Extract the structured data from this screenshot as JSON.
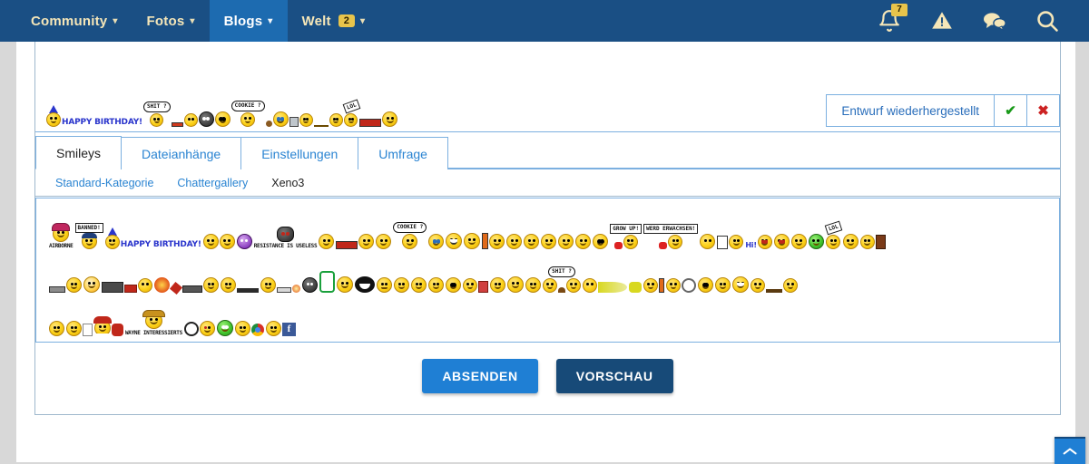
{
  "navbar": {
    "items": [
      {
        "label": "Community",
        "caret": true,
        "active": false,
        "badge": null
      },
      {
        "label": "Fotos",
        "caret": true,
        "active": false,
        "badge": null
      },
      {
        "label": "Blogs",
        "caret": true,
        "active": true,
        "badge": null
      },
      {
        "label": "Welt",
        "caret": true,
        "active": false,
        "badge": "2"
      }
    ],
    "icons": [
      {
        "name": "notification-bell-icon",
        "badge": "7"
      },
      {
        "name": "warning-triangle-icon",
        "badge": null
      },
      {
        "name": "messages-icon",
        "badge": null
      },
      {
        "name": "search-icon",
        "badge": null
      }
    ],
    "colors": {
      "bar": "#1a4f84",
      "active": "#1d6bb0",
      "text": "#f5e6b8",
      "badge": "#e8c44b"
    }
  },
  "draft_notice": {
    "label": "Entwurf wiederhergestellt",
    "accept_icon": "✔",
    "dismiss_icon": "✖"
  },
  "tabs": [
    {
      "label": "Smileys",
      "active": true
    },
    {
      "label": "Dateianhänge",
      "active": false
    },
    {
      "label": "Einstellungen",
      "active": false
    },
    {
      "label": "Umfrage",
      "active": false
    }
  ],
  "subtabs": [
    {
      "label": "Standard-Kategorie",
      "active": false
    },
    {
      "label": "Chattergallery",
      "active": false
    },
    {
      "label": "Xeno3",
      "active": true
    }
  ],
  "editor": {
    "inserted_smileys": [
      "birthday-smiley",
      "shit-bubble-smiley",
      "cigarette-smiley",
      "sunglasses-smiley",
      "goggles-smiley",
      "cookie-bubble-smiley",
      "crumb-smiley",
      "cry-smiley",
      "pc-smiley",
      "whistle-smiley",
      "lol-hammer-smiley",
      "chainsaw-smiley"
    ]
  },
  "smiley_panel": {
    "rows": [
      [
        {
          "name": "airborne-smiley",
          "caption": "AIRBORNE"
        },
        {
          "name": "banned-sign-smiley",
          "sign": "BANNED!"
        },
        {
          "name": "happy-birthday-smiley",
          "text": "HAPPY BIRTHDAY!"
        },
        {
          "name": "cheers-beer-smiley"
        },
        {
          "name": "borg-smiley"
        },
        {
          "name": "resistance-smiley",
          "caption": "RESISTANCE IS USELESS"
        },
        {
          "name": "scared-smiley"
        },
        {
          "name": "chainsaw-smiley"
        },
        {
          "name": "grin-smiley"
        },
        {
          "name": "cookie-bubble-smiley",
          "bubble": "COOKIE ?"
        },
        {
          "name": "crying-smiley"
        },
        {
          "name": "teeth-smiley"
        },
        {
          "name": "hands-up-smiley"
        },
        {
          "name": "thermometer-smiley"
        },
        {
          "name": "dizzy-smiley"
        },
        {
          "name": "sick-smiley"
        },
        {
          "name": "laugh-smiley"
        },
        {
          "name": "sleepy-smiley"
        },
        {
          "name": "pillow-smiley"
        },
        {
          "name": "sunglasses-smiley"
        },
        {
          "name": "grow-up-sign-smiley",
          "sign": "GROW UP!"
        },
        {
          "name": "werd-erwachsen-sign-smiley",
          "sign": "WERD ERWACHSEN!"
        },
        {
          "name": "running-smiley"
        },
        {
          "name": "notepad-smiley"
        },
        {
          "name": "hi-smiley",
          "text": "Hi!"
        },
        {
          "name": "tongue-smiley"
        },
        {
          "name": "confused-smiley"
        },
        {
          "name": "green-sick-smiley"
        },
        {
          "name": "lol-hammer-smiley",
          "sign": "LOL"
        },
        {
          "name": "wink-smiley"
        },
        {
          "name": "reading-smiley"
        }
      ],
      [
        {
          "name": "machinegun-smiley"
        },
        {
          "name": "sun-smiley"
        },
        {
          "name": "bazooka-smiley"
        },
        {
          "name": "explosion-smiley"
        },
        {
          "name": "knife-throw-smiley"
        },
        {
          "name": "gun-smiley"
        },
        {
          "name": "sniper-smiley"
        },
        {
          "name": "match-smiley"
        },
        {
          "name": "ninja-smiley"
        },
        {
          "name": "book-smiley"
        },
        {
          "name": "strong-smiley"
        },
        {
          "name": "monster-smiley"
        },
        {
          "name": "zip-mouth-smiley"
        },
        {
          "name": "angry-point-smiley"
        },
        {
          "name": "shush-smiley"
        },
        {
          "name": "cheeky-smiley"
        },
        {
          "name": "glasses-smiley"
        },
        {
          "name": "popcorn-smiley"
        },
        {
          "name": "bored-smiley"
        },
        {
          "name": "shrug-smiley"
        },
        {
          "name": "smile-smiley"
        },
        {
          "name": "shit-bubble-smiley",
          "bubble": "SHIT ?"
        },
        {
          "name": "vomit-smiley"
        },
        {
          "name": "spray-smiley"
        },
        {
          "name": "thermometer2-smiley"
        },
        {
          "name": "magnifier-smiley"
        },
        {
          "name": "nerd-smiley"
        },
        {
          "name": "smirk-smiley"
        },
        {
          "name": "big-grin-smiley"
        },
        {
          "name": "slap-smiley"
        },
        {
          "name": "sad-smiley"
        }
      ],
      [
        {
          "name": "happy-smiley"
        },
        {
          "name": "whistle-smiley"
        },
        {
          "name": "santa-smiley"
        },
        {
          "name": "wayne-cowboy-smiley",
          "caption": "WAYNE INTERESSIERTS"
        },
        {
          "name": "pirate-smiley"
        },
        {
          "name": "alien-smiley"
        },
        {
          "name": "chrome-love-smiley"
        },
        {
          "name": "facebook-love-smiley"
        }
      ]
    ]
  },
  "actions": {
    "submit_label": "ABSENDEN",
    "preview_label": "VORSCHAU",
    "submit_color": "#1f7fd4",
    "preview_color": "#174a78"
  },
  "scroll_top": {
    "name": "scroll-to-top-button",
    "icon": "chevron-up-icon"
  }
}
